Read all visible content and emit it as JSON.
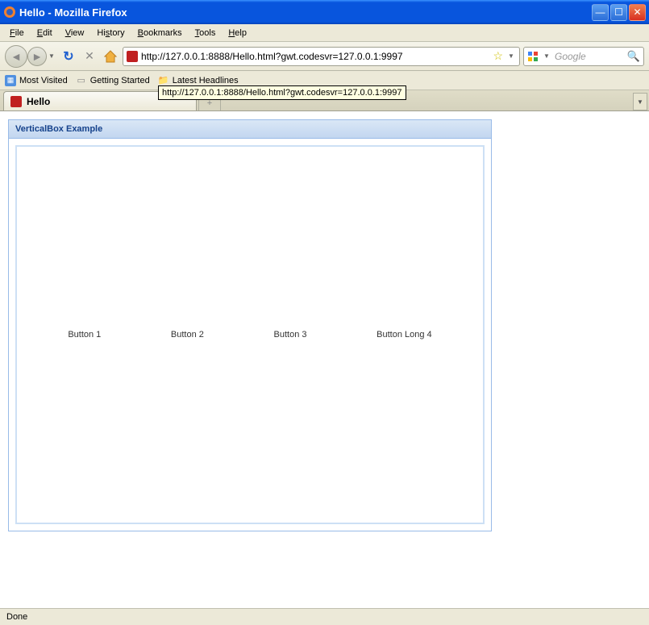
{
  "window": {
    "title": "Hello - Mozilla Firefox"
  },
  "menubar": {
    "file": "File",
    "edit": "Edit",
    "view": "View",
    "history": "History",
    "bookmarks": "Bookmarks",
    "tools": "Tools",
    "help": "Help"
  },
  "url": "http://127.0.0.1:8888/Hello.html?gwt.codesvr=127.0.0.1:9997",
  "tooltip": "http://127.0.0.1:8888/Hello.html?gwt.codesvr=127.0.0.1:9997",
  "search": {
    "placeholder": "Google"
  },
  "bookmarks_toolbar": {
    "most_visited": "Most Visited",
    "getting_started": "Getting Started",
    "latest_headlines": "Latest Headlines"
  },
  "tab": {
    "title": "Hello"
  },
  "panel": {
    "title": "VerticalBox Example",
    "buttons": [
      "Button 1",
      "Button 2",
      "Button 3",
      "Button Long 4"
    ]
  },
  "status": "Done"
}
